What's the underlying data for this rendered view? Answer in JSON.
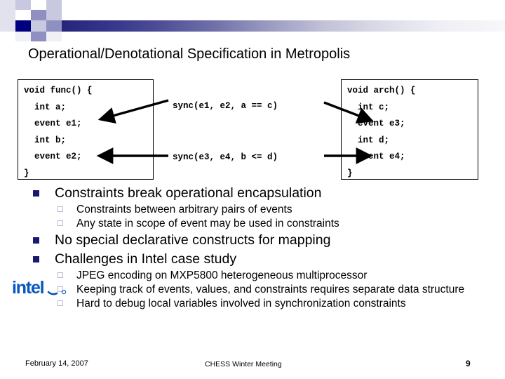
{
  "slide": {
    "title": "Operational/Denotational Specification in Metropolis",
    "accent_navy": "#000080",
    "accent_bullet": "#191970",
    "sub_bullet_border": "#b8b8d8",
    "intel_blue": "#0b56bd"
  },
  "code_left": {
    "name": "func",
    "lines": [
      "void func() {",
      "  int a;",
      "  event e1;",
      "  int b;",
      "  event e2;",
      "}"
    ]
  },
  "code_right": {
    "name": "arch",
    "lines": [
      "void arch() {",
      "  int c;",
      "  event e3;",
      "  int d;",
      "  event e4;",
      "}"
    ]
  },
  "constraints": [
    {
      "text": "sync(e1, e2, a == c)"
    },
    {
      "text": "sync(e3, e4, b <= d)"
    }
  ],
  "bullets": [
    {
      "level": 1,
      "text": "Constraints break operational encapsulation"
    },
    {
      "level": 2,
      "text": "Constraints between arbitrary pairs of events"
    },
    {
      "level": 2,
      "text": "Any state in scope of event may be used in constraints"
    },
    {
      "level": 1,
      "text": "No special declarative constructs for mapping"
    },
    {
      "level": 1,
      "text": "Challenges in Intel case study"
    },
    {
      "level": 2,
      "text": "JPEG encoding on MXP5800 heterogeneous multiprocessor"
    },
    {
      "level": 2,
      "text": "Keeping track of events, values, and constraints requires separate data structure"
    },
    {
      "level": 2,
      "text": "Hard to debug local variables involved in synchronization constraints"
    }
  ],
  "logo": {
    "name": "intel-logo",
    "wordmark": "intel",
    "registered": "®"
  },
  "footer": {
    "date": "February 14, 2007",
    "center": "CHESS Winter Meeting",
    "page": "9"
  }
}
